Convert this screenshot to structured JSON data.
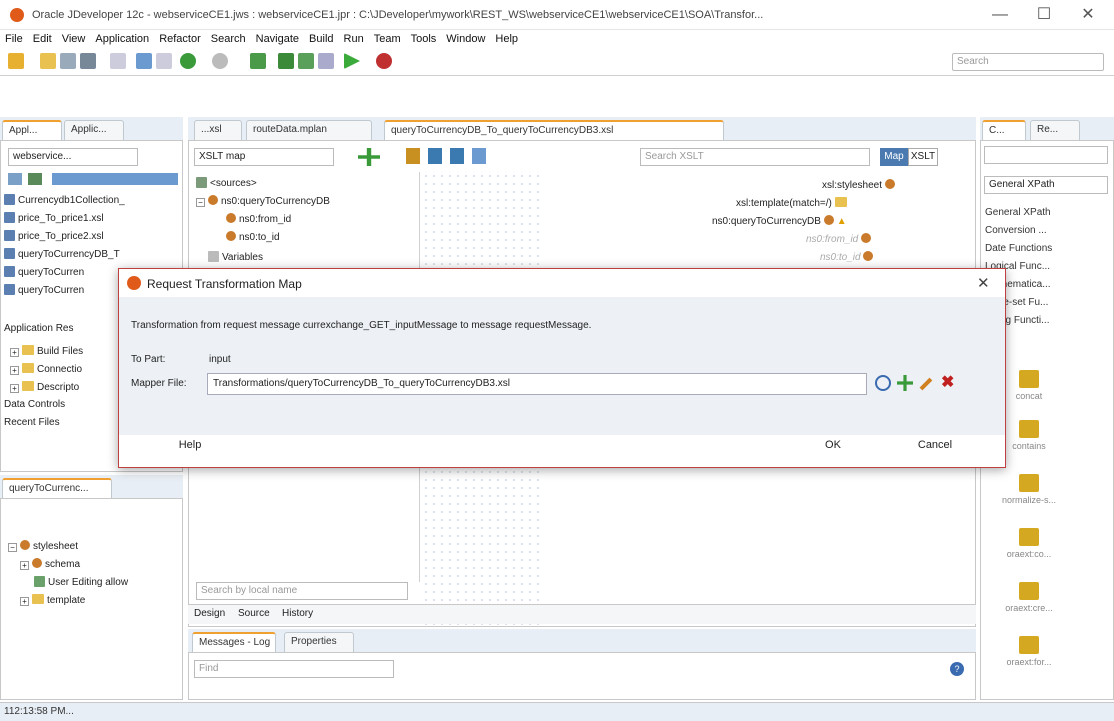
{
  "window": {
    "title": "Oracle JDeveloper 12c - webserviceCE1.jws : webserviceCE1.jpr : C:\\JDeveloper\\mywork\\REST_WS\\webserviceCE1\\webserviceCE1\\SOA\\Transfor...",
    "minimize": "—",
    "maximize": "☐",
    "close": "✕"
  },
  "menu": [
    "File",
    "Edit",
    "View",
    "Application",
    "Refactor",
    "Search",
    "Navigate",
    "Build",
    "Run",
    "Team",
    "Tools",
    "Window",
    "Help"
  ],
  "toolbar": {
    "search_placeholder": "Search"
  },
  "left_panel": {
    "tabs": [
      "Appl...",
      "Applic..."
    ],
    "app_select": "webservice...",
    "files": [
      "Currencydb1Collection_",
      "price_To_price1.xsl",
      "price_To_price2.xsl",
      "queryToCurrencyDB_T",
      "queryToCurren",
      "queryToCurren"
    ],
    "sections": [
      "Application Res",
      "Data Controls",
      "Recent Files"
    ],
    "folders": [
      "Build Files",
      "Connectio",
      "Descripto"
    ]
  },
  "structure_panel": {
    "tab": "queryToCurrenc...",
    "tree": [
      "stylesheet",
      "schema",
      "User Editing allow",
      "template"
    ]
  },
  "editor": {
    "tabs": [
      "...xsl",
      "routeData.mplan",
      "queryToCurrencyDB_To_queryToCurrencyDB3.xsl"
    ],
    "map_select": "XSLT map",
    "search_xslt": "Search XSLT",
    "mode_map": "Map",
    "mode_xslt": "XSLT",
    "sources_tree": [
      "<sources>",
      "ns0:queryToCurrencyDB",
      "ns0:from_id",
      "ns0:to_id",
      "Variables"
    ],
    "target_tree": [
      "xsl:stylesheet",
      "xsl:template(match=/)",
      "ns0:queryToCurrencyDB",
      "ns0:from_id",
      "ns0:to_id"
    ],
    "search_local": "Search by local name",
    "bottom_tabs": [
      "Design",
      "Source",
      "History"
    ]
  },
  "log_panel": {
    "tabs": [
      "Messages - Log",
      "Properties"
    ],
    "find_placeholder": "Find"
  },
  "right_panel": {
    "tabs": [
      "C...",
      "Re..."
    ],
    "category_select": "General XPath",
    "categories": [
      "General XPath",
      "Conversion ...",
      "Date Functions",
      "Logical Func...",
      "Mathematica...",
      "Node-set Fu...",
      "String Functi..."
    ],
    "palette": [
      "concat",
      "contains",
      "normalize-s...",
      "oraext:co...",
      "oraext:cre...",
      "oraext:for..."
    ]
  },
  "dialog": {
    "title": "Request Transformation Map",
    "description": "Transformation from request message currexchange_GET_inputMessage to message requestMessage.",
    "to_part_label": "To Part:",
    "to_part_value": "input",
    "mapper_label": "Mapper File:",
    "mapper_value": "Transformations/queryToCurrencyDB_To_queryToCurrencyDB3.xsl",
    "help": "Help",
    "ok": "OK",
    "cancel": "Cancel"
  },
  "status": {
    "time": "112:13:58 PM..."
  }
}
